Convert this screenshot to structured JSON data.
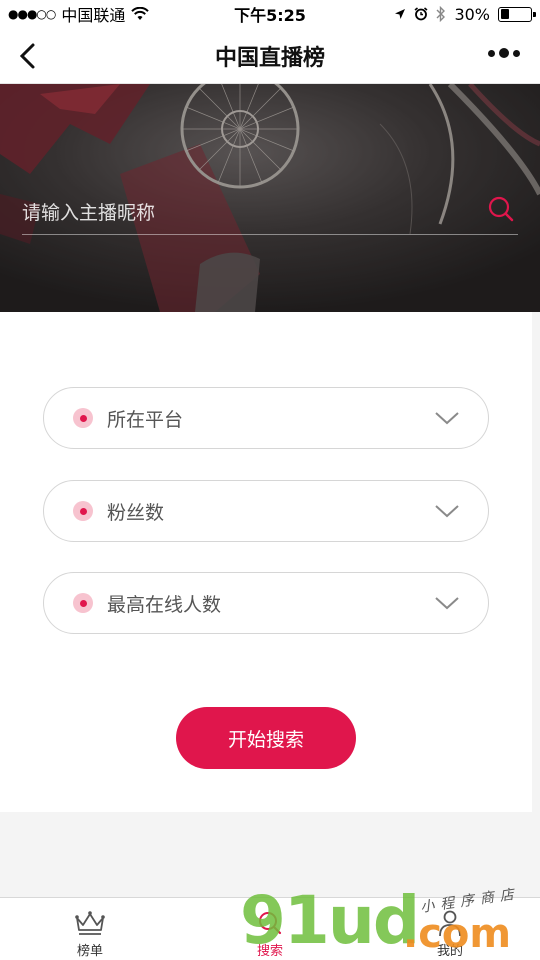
{
  "status_bar": {
    "signal": "●●●○○",
    "carrier": "中国联通",
    "time": "下午5:25",
    "battery_percent": "30%",
    "battery_level": 0.3
  },
  "nav": {
    "title": "中国直播榜"
  },
  "hero": {
    "search_placeholder": "请输入主播昵称"
  },
  "filters": [
    {
      "label": "所在平台"
    },
    {
      "label": "粉丝数"
    },
    {
      "label": "最高在线人数"
    }
  ],
  "start_button": "开始搜索",
  "tabs": [
    {
      "label": "榜单",
      "icon": "crown-icon"
    },
    {
      "label": "搜索",
      "icon": "search-icon",
      "active": true
    },
    {
      "label": "我的",
      "icon": "user-icon"
    }
  ],
  "watermark": {
    "main": "91ud",
    "suffix": ".com",
    "sub": "小程序商店"
  },
  "colors": {
    "accent": "#e0164c",
    "dot_bg": "#f7c3cf",
    "hero_bg": "#333030"
  }
}
